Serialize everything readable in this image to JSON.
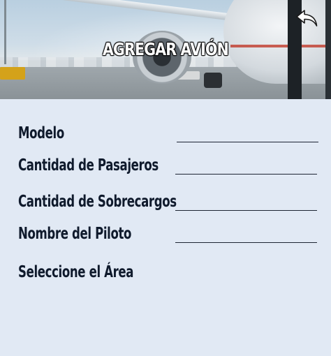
{
  "header": {
    "title": "AGREGAR AVIÓN",
    "back_icon": "back-arrow-icon"
  },
  "form": {
    "fields": [
      {
        "label": "Modelo",
        "value": ""
      },
      {
        "label": "Cantidad de Pasajeros",
        "value": ""
      },
      {
        "label": "Cantidad de Sobrecargos",
        "value": ""
      },
      {
        "label": "Nombre del Piloto",
        "value": ""
      }
    ],
    "area_label": "Seleccione el Área"
  },
  "colors": {
    "background": "#e1e9f4",
    "label_text": "#0f1a2c",
    "underline": "#1d2433",
    "title_text": "#ffffff"
  }
}
